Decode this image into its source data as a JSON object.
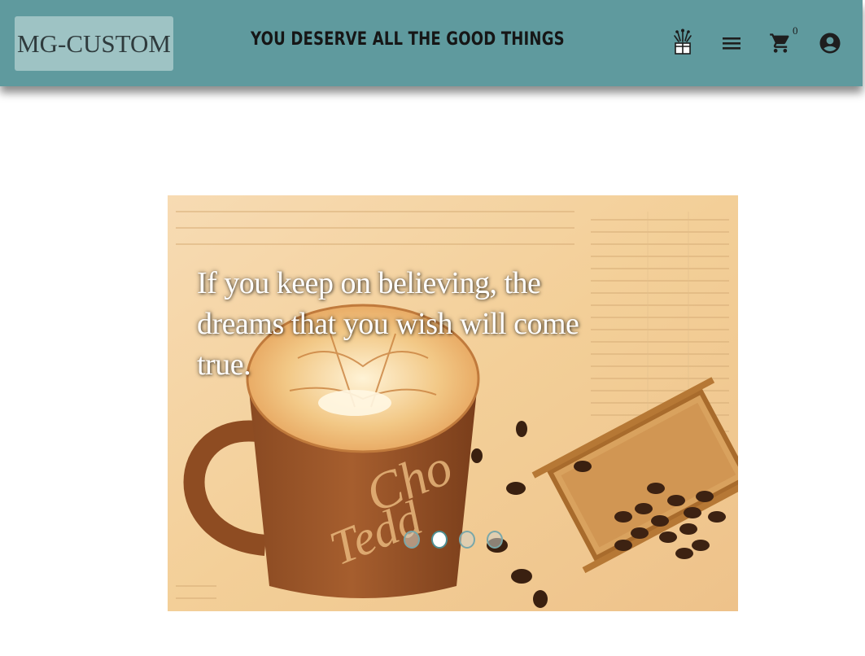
{
  "header": {
    "logo_text": "MG-CUSTOM",
    "tagline": "You deserve all the good things",
    "background_color": "#5f9a9e",
    "cart_count": "0",
    "icons": [
      "gift-icon",
      "menu-icon",
      "cart-icon",
      "account-icon"
    ]
  },
  "carousel": {
    "caption": "If you keep on believing, the dreams that you wish will come true.",
    "slide_count": 4,
    "active_index": 1
  }
}
